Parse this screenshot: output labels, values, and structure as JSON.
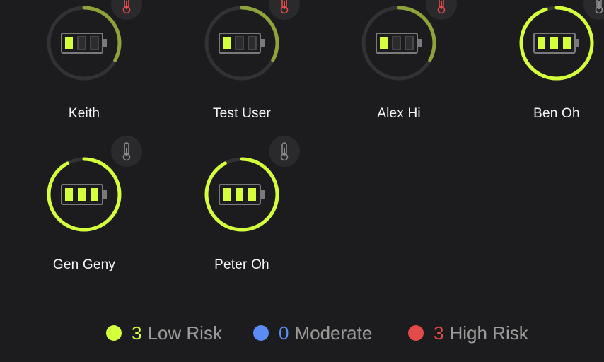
{
  "colors": {
    "low": "#d4ff3a",
    "low_dim": "#8ea43a",
    "moderate": "#5b8cf5",
    "high": "#e34b4b",
    "track": "#323234",
    "empty_cell": "#3a3a3c"
  },
  "users": [
    {
      "name": "Keith",
      "level": 0.33,
      "cells": 1,
      "risk": "high",
      "icon": "thermometer-icon"
    },
    {
      "name": "Test User",
      "level": 0.33,
      "cells": 1,
      "risk": "high",
      "icon": "thermometer-icon"
    },
    {
      "name": "Alex Hi",
      "level": 0.33,
      "cells": 1,
      "risk": "high",
      "icon": "thermometer-icon"
    },
    {
      "name": "Ben Oh",
      "level": 0.95,
      "cells": 3,
      "risk": "low",
      "icon": "thermometer-icon"
    },
    {
      "name": "Gen Geny",
      "level": 0.92,
      "cells": 3,
      "risk": "low",
      "icon": "thermometer-icon"
    },
    {
      "name": "Peter Oh",
      "level": 0.92,
      "cells": 3,
      "risk": "low",
      "icon": "thermometer-icon"
    }
  ],
  "legend": {
    "low": {
      "count": "3",
      "label": "Low Risk"
    },
    "moderate": {
      "count": "0",
      "label": "Moderate"
    },
    "high": {
      "count": "3",
      "label": "High Risk"
    }
  }
}
